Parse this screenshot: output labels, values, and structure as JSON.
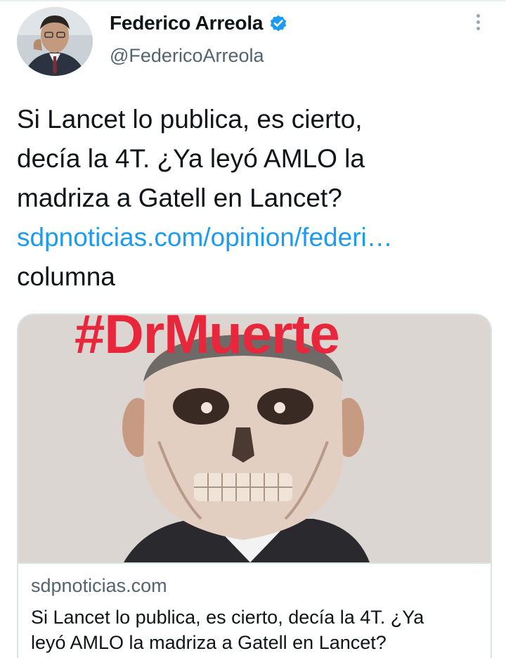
{
  "author": {
    "name": "Federico Arreola",
    "handle": "@FedericoArreola",
    "verified": true
  },
  "tweet": {
    "lines": [
      "Si Lancet lo publica, es cierto,",
      "decía la 4T. ¿Ya leyó AMLO la",
      "madriza a Gatell en Lancet?"
    ],
    "link": "sdpnoticias.com/opinion/federi…",
    "trailing": "columna"
  },
  "card": {
    "image_text": "#DrMuerte",
    "domain": "sdpnoticias.com",
    "title_lines": [
      "Si Lancet lo publica, es cierto, decía la 4T. ¿Ya",
      "leyó AMLO la madriza a Gatell en Lancet?"
    ]
  },
  "icons": {
    "verified": "verified-badge-icon",
    "more": "more-options-icon"
  },
  "colors": {
    "link": "#1d9bf0",
    "secondary_text": "#536471",
    "hashtag_red": "#e8263c"
  }
}
